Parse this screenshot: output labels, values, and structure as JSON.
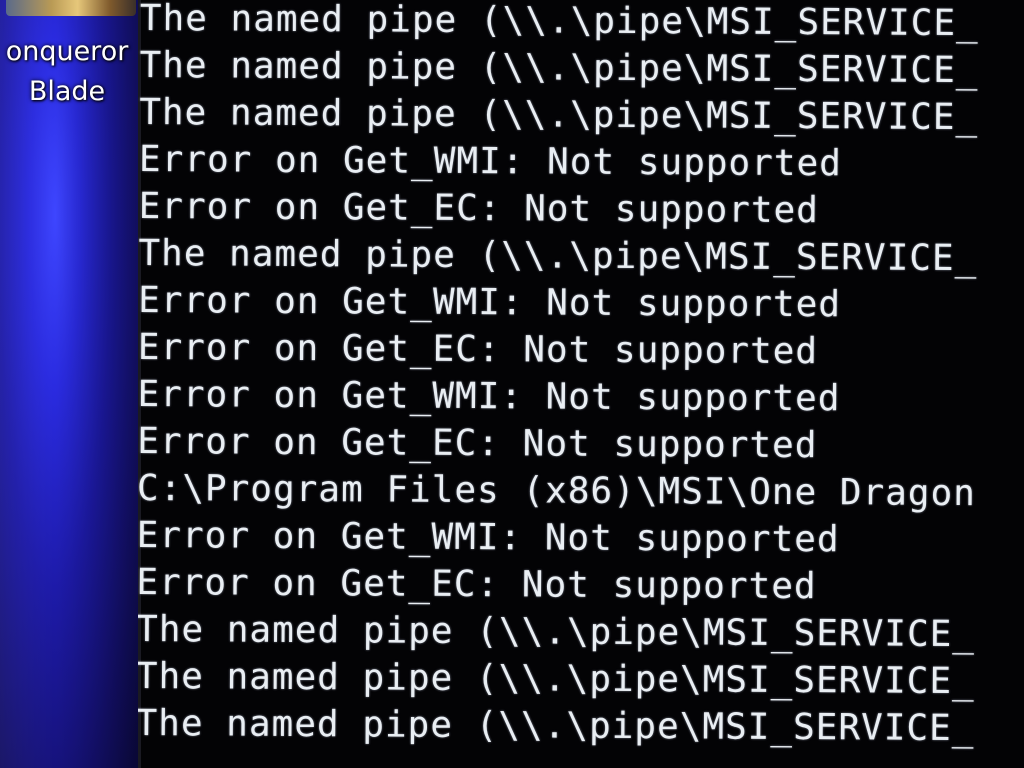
{
  "desktop": {
    "icon_label": "onqueror\nBlade"
  },
  "console": {
    "lines": [
      "The named pipe (\\\\.\\pipe\\MSI_SERVICE_",
      "The named pipe (\\\\.\\pipe\\MSI_SERVICE_",
      "The named pipe (\\\\.\\pipe\\MSI_SERVICE_",
      "Error on Get_WMI: Not supported",
      "Error on Get_EC: Not supported",
      "The named pipe (\\\\.\\pipe\\MSI_SERVICE_",
      "Error on Get_WMI: Not supported",
      "Error on Get_EC: Not supported",
      "Error on Get_WMI: Not supported",
      "Error on Get_EC: Not supported",
      "C:\\Program Files (x86)\\MSI\\One Dragon",
      "Error on Get_WMI: Not supported",
      "Error on Get_EC: Not supported",
      "The named pipe (\\\\.\\pipe\\MSI_SERVICE_",
      "The named pipe (\\\\.\\pipe\\MSI_SERVICE_",
      "The named pipe (\\\\.\\pipe\\MSI_SERVICE_"
    ]
  }
}
